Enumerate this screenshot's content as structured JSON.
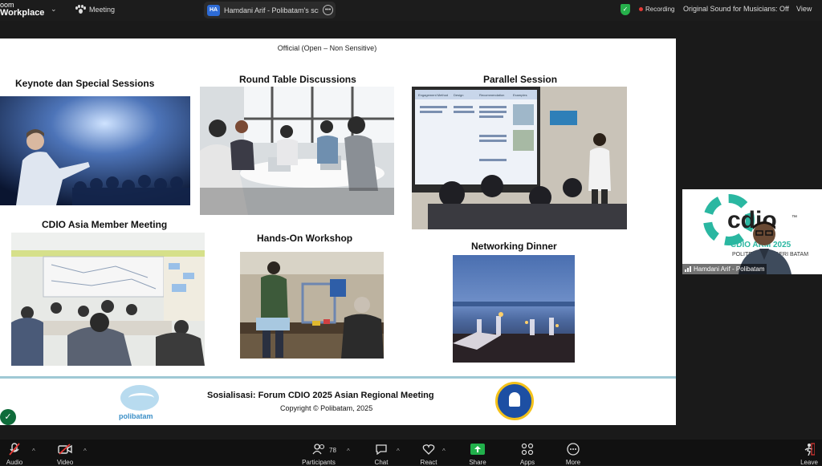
{
  "app": {
    "brand_line1": "oom",
    "brand_line2": "Workplace"
  },
  "topbar": {
    "meeting_label": "Meeting",
    "share_badge": "HA",
    "share_title": "Hamdani Arif - Polibatam's scree",
    "recording_label": "Recording",
    "original_sound_label": "Original Sound for Musicians: Off",
    "view_label": "View"
  },
  "slide": {
    "classification": "Official (Open – Non Sensitive)",
    "sections": [
      "Keynote dan Special Sessions",
      "Round Table Discussions",
      "Parallel Session",
      "CDIO Asia Member Meeting",
      "Hands-On Workshop",
      "Networking Dinner"
    ],
    "screen_headers": [
      "Engagement Method",
      "Design",
      "Recommendation",
      "Examples"
    ],
    "footer_title": "Sosialisasi: Forum CDIO 2025 Asian Regional Meeting",
    "footer_copyright": "Copyright © Polibatam, 2025",
    "logo_text": "polibatam"
  },
  "video_tile": {
    "logo_text": "cdio",
    "logo_tm": "™",
    "banner": "CDIO ARM 2025",
    "banner_sub": "POLITEKNIK NEGERI BATAM",
    "participant_name": "Hamdani Arif - Polibatam"
  },
  "toolbar": {
    "audio": "Audio",
    "video": "Video",
    "participants": "Participants",
    "participants_count": "78",
    "chat": "Chat",
    "react": "React",
    "share": "Share",
    "apps": "Apps",
    "more": "More",
    "leave": "Leave"
  },
  "colors": {
    "share_green": "#21b04b",
    "accent_blue": "#2d6bd6",
    "recording_red": "#e53935",
    "divider_teal": "#9fc9d5",
    "cdio_teal": "#2ab7a1"
  }
}
